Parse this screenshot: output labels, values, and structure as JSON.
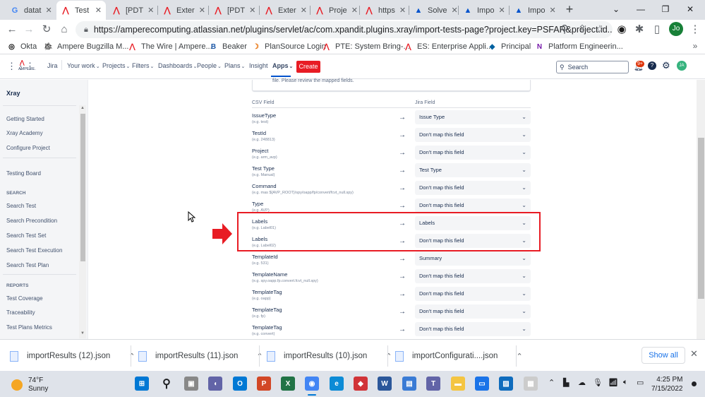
{
  "browser": {
    "tabs": [
      {
        "title": "datat",
        "icon": "google-icon",
        "color": "#4285f4"
      },
      {
        "title": "Test",
        "icon": "atlassian-red-icon",
        "color": "#e81c24",
        "active": true
      },
      {
        "title": "[PDT",
        "icon": "atlassian-red-icon",
        "color": "#e81c24"
      },
      {
        "title": "Exter",
        "icon": "atlassian-red-icon",
        "color": "#e81c24"
      },
      {
        "title": "[PDT",
        "icon": "atlassian-red-icon",
        "color": "#e81c24"
      },
      {
        "title": "Exter",
        "icon": "atlassian-red-icon",
        "color": "#e81c24"
      },
      {
        "title": "Proje",
        "icon": "atlassian-red-icon",
        "color": "#e81c24"
      },
      {
        "title": "https",
        "icon": "atlassian-red-icon",
        "color": "#e81c24"
      },
      {
        "title": "Solve",
        "icon": "atlassian-blue-icon",
        "color": "#0052cc"
      },
      {
        "title": "Impo",
        "icon": "atlassian-blue-icon",
        "color": "#0052cc"
      },
      {
        "title": "Impo",
        "icon": "atlassian-blue-icon",
        "color": "#0052cc"
      }
    ],
    "url": "https://amperecomputing.atlassian.net/plugins/servlet/ac/com.xpandit.plugins.xray/import-tests-page?project.key=PSFAR&project.id...",
    "profile_initials": "Jo",
    "bookmarks": [
      {
        "label": "Okta",
        "icon": "okta-icon"
      },
      {
        "label": "Ampere Bugzilla M...",
        "icon": "bugzilla-icon"
      },
      {
        "label": "The Wire | Ampere...",
        "icon": "ampere-icon"
      },
      {
        "label": "Beaker",
        "icon": "beaker-icon"
      },
      {
        "label": "PlanSource Login",
        "icon": "plansource-icon"
      },
      {
        "label": "PTE: System Bring-...",
        "icon": "atlassian-red-icon"
      },
      {
        "label": "ES: Enterprise Appli...",
        "icon": "atlassian-red-icon"
      },
      {
        "label": "Principal",
        "icon": "principal-icon"
      },
      {
        "label": "Platform Engineerin...",
        "icon": "onenote-icon"
      }
    ]
  },
  "jira": {
    "logo": "AMPERE.",
    "product": "Jira",
    "nav": [
      "Your work",
      "Projects",
      "Filters",
      "Dashboards",
      "People",
      "Plans",
      "Insight",
      "Apps"
    ],
    "create_label": "Create",
    "search_placeholder": "Search",
    "notifications_badge": "9+",
    "user_initials": "JA"
  },
  "sidebar": {
    "title": "Xray",
    "items": [
      "Getting Started",
      "Xray Academy",
      "Configure Project"
    ],
    "testing_board": "Testing Board",
    "search_heading": "SEARCH",
    "search_items": [
      "Search Test",
      "Search Precondition",
      "Search Test Set",
      "Search Test Execution",
      "Search Test Plan"
    ],
    "reports_heading": "REPORTS",
    "report_items": [
      "Test Coverage",
      "Traceability",
      "Test Plans Metrics"
    ]
  },
  "mapping": {
    "top_message": "file. Please review the mapped fields.",
    "csv_header": "CSV Field",
    "jira_header": "Jira Field",
    "rows": [
      {
        "csv": "IssueType",
        "example": "(e.g. test)",
        "jira": "Issue Type"
      },
      {
        "csv": "TestId",
        "example": "(e.g. 248813)",
        "jira": "Don't map this field"
      },
      {
        "csv": "Project",
        "example": "(e.g. arm_avp)",
        "jira": "Don't map this field"
      },
      {
        "csv": "Test Type",
        "example": "(e.g. Manual)",
        "jira": "Test Type"
      },
      {
        "csv": "Command",
        "example": "(e.g. mas ${AVP_ROOT}/spy/oapp/fp/convert/fcvt_null.spy)",
        "jira": "Don't map this field"
      },
      {
        "csv": "Type",
        "example": "(e.g. AVP)",
        "jira": "Don't map this field"
      },
      {
        "csv": "Labels",
        "example": "(e.g. Label01)",
        "jira": "Labels"
      },
      {
        "csv": "Labels",
        "example": "(e.g. Label02)",
        "jira": "Don't map this field"
      },
      {
        "csv": "TemplateId",
        "example": "(e.g. 531)",
        "jira": "Summary"
      },
      {
        "csv": "TemplateName",
        "example": "(e.g. spy.oapp.fp.convert.fcvt_null.spy)",
        "jira": "Don't map this field"
      },
      {
        "csv": "TemplateTag",
        "example": "(e.g. oapp)",
        "jira": "Don't map this field"
      },
      {
        "csv": "TemplateTag",
        "example": "(e.g. fp)",
        "jira": "Don't map this field"
      },
      {
        "csv": "TemplateTag",
        "example": "(e.g. convert)",
        "jira": "Don't map this field"
      }
    ]
  },
  "downloads": {
    "files": [
      "importResults (12).json",
      "importResults (11).json",
      "importResults (10).json",
      "importConfigurati....json"
    ],
    "show_all": "Show all"
  },
  "taskbar": {
    "temperature": "74°F",
    "condition": "Sunny",
    "time": "4:25 PM",
    "date": "7/15/2022"
  }
}
